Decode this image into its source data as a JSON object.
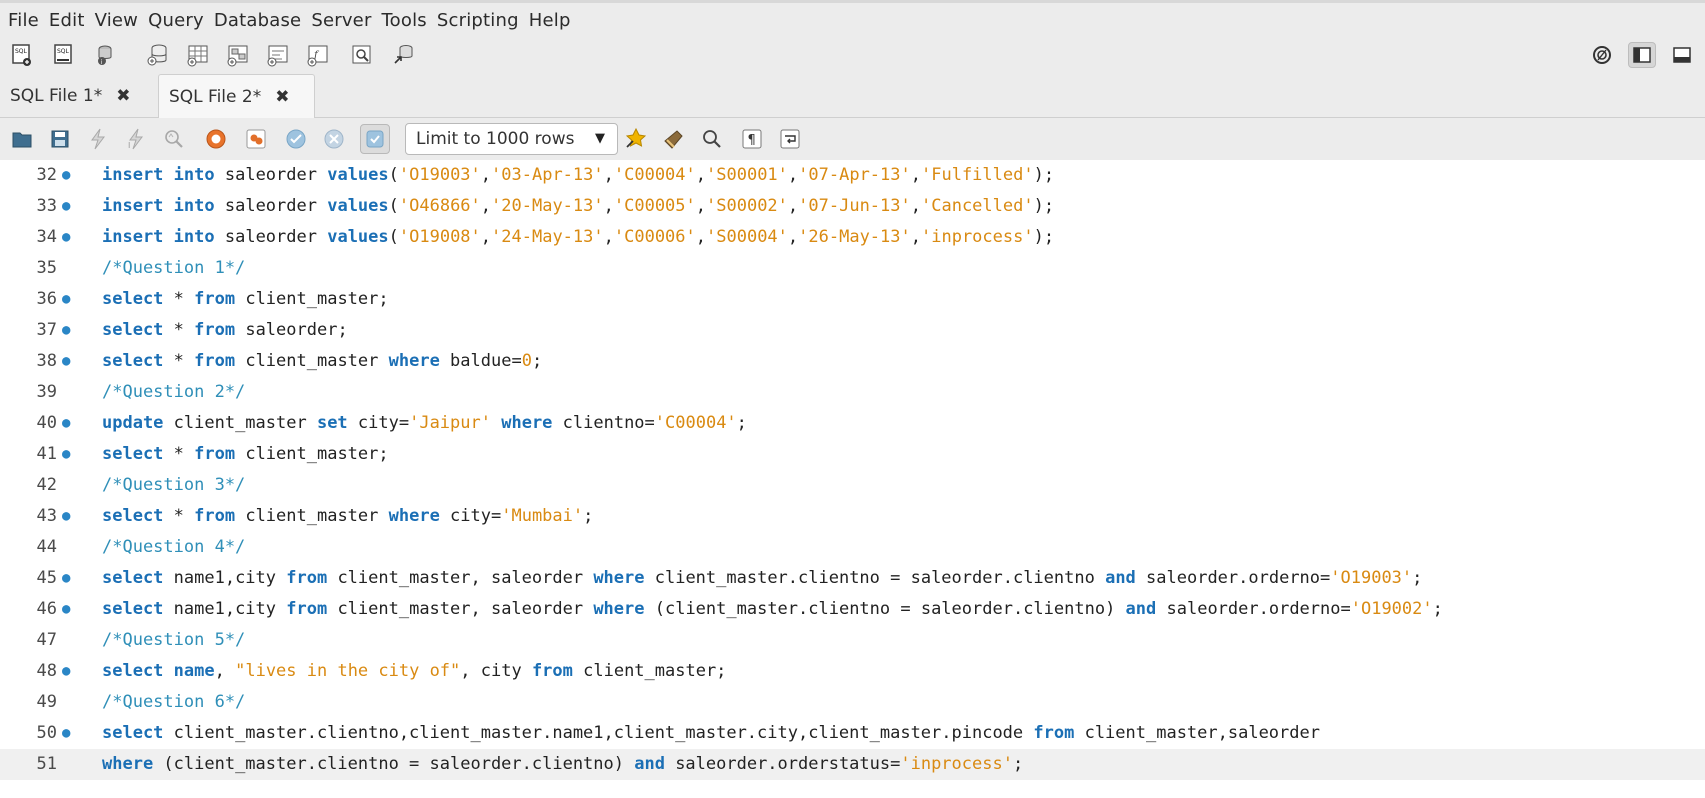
{
  "menu": [
    "File",
    "Edit",
    "View",
    "Query",
    "Database",
    "Server",
    "Tools",
    "Scripting",
    "Help"
  ],
  "main_toolbar": {
    "icons": [
      "new-sql-tab-icon",
      "open-sql-script-icon",
      "inspector-icon",
      "create-schema-icon",
      "create-table-icon",
      "create-view-icon",
      "create-procedure-icon",
      "create-function-icon",
      "search-table-data-icon",
      "reconnect-icon"
    ],
    "right_icons": [
      "workbench-logo-icon",
      "toggle-sidebar-icon",
      "toggle-output-panel-icon"
    ]
  },
  "tabs": [
    {
      "label": "SQL File 1*",
      "active": false
    },
    {
      "label": "SQL File 2*",
      "active": true
    }
  ],
  "editor_toolbar": {
    "icons": [
      "open-file-icon",
      "save-icon",
      "execute-icon",
      "execute-current-icon",
      "explain-icon",
      "stop-icon",
      "toggle-error-icon",
      "commit-icon",
      "rollback-icon",
      "autocommit-icon",
      "beautify-icon",
      "snippets-icon",
      "find-icon",
      "invisible-chars-icon",
      "wrap-lines-icon"
    ],
    "limit_select": "Limit to 1000 rows"
  },
  "colors": {
    "keyword": "#1b6fb5",
    "string": "#d98a12",
    "comment": "#2f8fb8",
    "plain": "#222222",
    "dot": "#2a86c6"
  },
  "code_lines": [
    {
      "n": "32",
      "dot": true,
      "tokens": [
        [
          "kw",
          "insert"
        ],
        [
          "p",
          " "
        ],
        [
          "kw",
          "into"
        ],
        [
          "p",
          " saleorder "
        ],
        [
          "kw",
          "values"
        ],
        [
          "p",
          "("
        ],
        [
          "s",
          "'O19003'"
        ],
        [
          "p",
          ","
        ],
        [
          "s",
          "'03-Apr-13'"
        ],
        [
          "p",
          ","
        ],
        [
          "s",
          "'C00004'"
        ],
        [
          "p",
          ","
        ],
        [
          "s",
          "'S00001'"
        ],
        [
          "p",
          ","
        ],
        [
          "s",
          "'07-Apr-13'"
        ],
        [
          "p",
          ","
        ],
        [
          "s",
          "'Fulfilled'"
        ],
        [
          "p",
          ");"
        ]
      ]
    },
    {
      "n": "33",
      "dot": true,
      "tokens": [
        [
          "kw",
          "insert"
        ],
        [
          "p",
          " "
        ],
        [
          "kw",
          "into"
        ],
        [
          "p",
          " saleorder "
        ],
        [
          "kw",
          "values"
        ],
        [
          "p",
          "("
        ],
        [
          "s",
          "'O46866'"
        ],
        [
          "p",
          ","
        ],
        [
          "s",
          "'20-May-13'"
        ],
        [
          "p",
          ","
        ],
        [
          "s",
          "'C00005'"
        ],
        [
          "p",
          ","
        ],
        [
          "s",
          "'S00002'"
        ],
        [
          "p",
          ","
        ],
        [
          "s",
          "'07-Jun-13'"
        ],
        [
          "p",
          ","
        ],
        [
          "s",
          "'Cancelled'"
        ],
        [
          "p",
          ");"
        ]
      ]
    },
    {
      "n": "34",
      "dot": true,
      "tokens": [
        [
          "kw",
          "insert"
        ],
        [
          "p",
          " "
        ],
        [
          "kw",
          "into"
        ],
        [
          "p",
          " saleorder "
        ],
        [
          "kw",
          "values"
        ],
        [
          "p",
          "("
        ],
        [
          "s",
          "'O19008'"
        ],
        [
          "p",
          ","
        ],
        [
          "s",
          "'24-May-13'"
        ],
        [
          "p",
          ","
        ],
        [
          "s",
          "'C00006'"
        ],
        [
          "p",
          ","
        ],
        [
          "s",
          "'S00004'"
        ],
        [
          "p",
          ","
        ],
        [
          "s",
          "'26-May-13'"
        ],
        [
          "p",
          ","
        ],
        [
          "s",
          "'inprocess'"
        ],
        [
          "p",
          ");"
        ]
      ]
    },
    {
      "n": "35",
      "dot": false,
      "tokens": [
        [
          "c",
          "/*Question 1*/"
        ]
      ]
    },
    {
      "n": "36",
      "dot": true,
      "tokens": [
        [
          "kw",
          "select"
        ],
        [
          "p",
          " * "
        ],
        [
          "kw",
          "from"
        ],
        [
          "p",
          " client_master;"
        ]
      ]
    },
    {
      "n": "37",
      "dot": true,
      "tokens": [
        [
          "kw",
          "select"
        ],
        [
          "p",
          " * "
        ],
        [
          "kw",
          "from"
        ],
        [
          "p",
          " saleorder;"
        ]
      ]
    },
    {
      "n": "38",
      "dot": true,
      "tokens": [
        [
          "kw",
          "select"
        ],
        [
          "p",
          " * "
        ],
        [
          "kw",
          "from"
        ],
        [
          "p",
          " client_master "
        ],
        [
          "kw",
          "where"
        ],
        [
          "p",
          " baldue="
        ],
        [
          "s",
          "0"
        ],
        [
          "p",
          ";"
        ]
      ]
    },
    {
      "n": "39",
      "dot": false,
      "tokens": [
        [
          "c",
          "/*Question 2*/"
        ]
      ]
    },
    {
      "n": "40",
      "dot": true,
      "tokens": [
        [
          "kw",
          "update"
        ],
        [
          "p",
          " client_master "
        ],
        [
          "kw",
          "set"
        ],
        [
          "p",
          " city="
        ],
        [
          "s",
          "'Jaipur'"
        ],
        [
          "p",
          " "
        ],
        [
          "kw",
          "where"
        ],
        [
          "p",
          " clientno="
        ],
        [
          "s",
          "'C00004'"
        ],
        [
          "p",
          ";"
        ]
      ]
    },
    {
      "n": "41",
      "dot": true,
      "tokens": [
        [
          "kw",
          "select"
        ],
        [
          "p",
          " * "
        ],
        [
          "kw",
          "from"
        ],
        [
          "p",
          " client_master;"
        ]
      ]
    },
    {
      "n": "42",
      "dot": false,
      "tokens": [
        [
          "c",
          "/*Question 3*/"
        ]
      ]
    },
    {
      "n": "43",
      "dot": true,
      "tokens": [
        [
          "kw",
          "select"
        ],
        [
          "p",
          " * "
        ],
        [
          "kw",
          "from"
        ],
        [
          "p",
          " client_master "
        ],
        [
          "kw",
          "where"
        ],
        [
          "p",
          " city="
        ],
        [
          "s",
          "'Mumbai'"
        ],
        [
          "p",
          ";"
        ]
      ]
    },
    {
      "n": "44",
      "dot": false,
      "tokens": [
        [
          "c",
          "/*Question 4*/"
        ]
      ]
    },
    {
      "n": "45",
      "dot": true,
      "tokens": [
        [
          "kw",
          "select"
        ],
        [
          "p",
          " name1,city "
        ],
        [
          "kw",
          "from"
        ],
        [
          "p",
          " client_master, saleorder "
        ],
        [
          "kw",
          "where"
        ],
        [
          "p",
          " client_master.clientno = saleorder.clientno "
        ],
        [
          "kw",
          "and"
        ],
        [
          "p",
          " saleorder.orderno="
        ],
        [
          "s",
          "'O19003'"
        ],
        [
          "p",
          ";"
        ]
      ]
    },
    {
      "n": "46",
      "dot": true,
      "tokens": [
        [
          "kw",
          "select"
        ],
        [
          "p",
          " name1,city "
        ],
        [
          "kw",
          "from"
        ],
        [
          "p",
          " client_master, saleorder "
        ],
        [
          "kw",
          "where"
        ],
        [
          "p",
          " (client_master.clientno = saleorder.clientno) "
        ],
        [
          "kw",
          "and"
        ],
        [
          "p",
          " saleorder.orderno="
        ],
        [
          "s",
          "'O19002'"
        ],
        [
          "p",
          ";"
        ]
      ]
    },
    {
      "n": "47",
      "dot": false,
      "tokens": [
        [
          "c",
          "/*Question 5*/"
        ]
      ]
    },
    {
      "n": "48",
      "dot": true,
      "tokens": [
        [
          "kw",
          "select"
        ],
        [
          "p",
          " "
        ],
        [
          "kw",
          "name"
        ],
        [
          "p",
          ", "
        ],
        [
          "s",
          "\"lives in the city of\""
        ],
        [
          "p",
          ", city "
        ],
        [
          "kw",
          "from"
        ],
        [
          "p",
          " client_master;"
        ]
      ]
    },
    {
      "n": "49",
      "dot": false,
      "tokens": [
        [
          "c",
          "/*Question 6*/"
        ]
      ]
    },
    {
      "n": "50",
      "dot": true,
      "tokens": [
        [
          "kw",
          "select"
        ],
        [
          "p",
          " client_master.clientno,client_master.name1,client_master.city,client_master.pincode "
        ],
        [
          "kw",
          "from"
        ],
        [
          "p",
          " client_master,saleorder"
        ]
      ]
    },
    {
      "n": "51",
      "dot": false,
      "current": true,
      "tokens": [
        [
          "kw",
          "where"
        ],
        [
          "p",
          " (client_master.clientno = saleorder.clientno) "
        ],
        [
          "kw",
          "and"
        ],
        [
          "p",
          " saleorder.orderstatus="
        ],
        [
          "s",
          "'inprocess'"
        ],
        [
          "p",
          ";"
        ]
      ]
    }
  ]
}
